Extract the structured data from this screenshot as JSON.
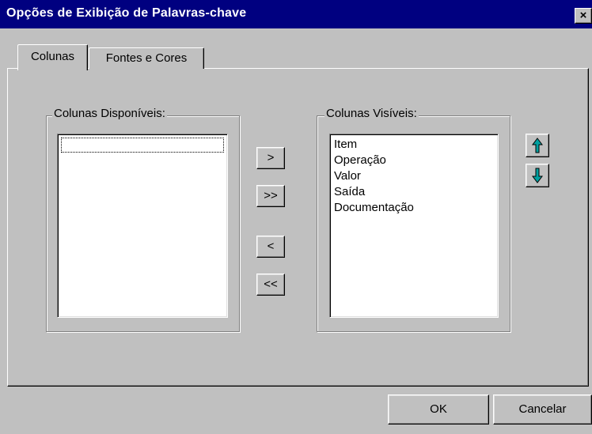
{
  "window": {
    "title": "Opções de Exibição de Palavras-chave",
    "close_glyph": "×"
  },
  "tabs": [
    {
      "label": "Colunas",
      "active": true
    },
    {
      "label": "Fontes e Cores",
      "active": false
    }
  ],
  "available_columns": {
    "label": "Colunas Disponíveis:",
    "items": []
  },
  "visible_columns": {
    "label": "Colunas Visíveis:",
    "items": [
      "Item",
      "Operação",
      "Valor",
      "Saída",
      "Documentação"
    ]
  },
  "transfer_buttons": {
    "add": ">",
    "add_all": ">>",
    "remove": "<",
    "remove_all": "<<"
  },
  "order_buttons": {
    "up_icon": "arrow-up-icon",
    "down_icon": "arrow-down-icon",
    "arrow_color": "#008080"
  },
  "footer": {
    "ok_label": "OK",
    "cancel_label": "Cancelar"
  }
}
